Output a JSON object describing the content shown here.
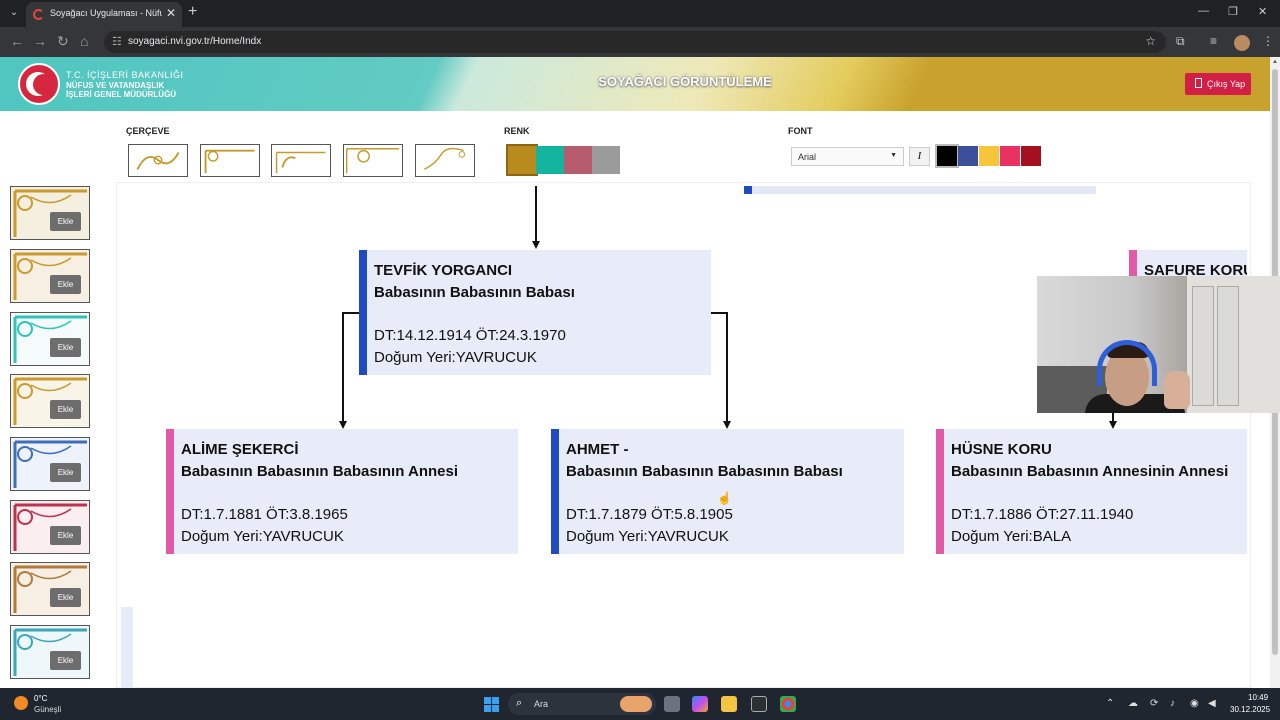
{
  "browser": {
    "tab_title": "Soyağacı Uygulaması - Nüfus ve Vatandaşlık",
    "tab_close": "✕",
    "new_tab": "+",
    "url": "soyagaci.nvi.gov.tr/Home/Indx",
    "window_controls": [
      "—",
      "❐",
      "✕"
    ]
  },
  "header": {
    "org_line1": "T.C. İÇİŞLERİ BAKANLIĞI",
    "org_line2": "NÜFUS VE VATANDAŞLIK",
    "org_line3": "İŞLERİ GENEL MÜDÜRLÜĞÜ",
    "title": "SOYAĞACI GÖRÜNTÜLEME",
    "logout_label": "Çıkış Yap"
  },
  "controls": {
    "frame_label": "ÇERÇEVE",
    "color_label": "RENK",
    "font_label": "FONT",
    "font_value": "Arial",
    "italic_label": "I",
    "frame_colors": [
      "#b98a1c",
      "#15b49e",
      "#b75c6e",
      "#9b9b9b"
    ],
    "font_colors": [
      "#000000",
      "#3b4f9a",
      "#f5c63a",
      "#ea3164",
      "#a4101f"
    ]
  },
  "themes": {
    "add_label": "Ekle",
    "items": [
      "gold-ornament",
      "gold-circle",
      "teal-lattice",
      "gold-frame",
      "blue-swirl",
      "red-ornament",
      "autumn-leaves",
      "teal-mosaic"
    ]
  },
  "tree": {
    "people": [
      {
        "name": "TEVFİK YORGANCI",
        "relation": "Babasının Babasının Babası",
        "dates": "DT:14.12.1914 ÖT:24.3.1970",
        "birthplace": "Doğum Yeri:YAVRUCUK",
        "gender": "male"
      },
      {
        "name": "ALİME ŞEKERCİ",
        "relation": "Babasının Babasının Babasının Annesi",
        "dates": "DT:1.7.1881 ÖT:3.8.1965",
        "birthplace": "Doğum Yeri:YAVRUCUK",
        "gender": "female"
      },
      {
        "name": "AHMET -",
        "relation": "Babasının Babasının Babasının Babası",
        "dates": "DT:1.7.1879 ÖT:5.8.1905",
        "birthplace": "Doğum Yeri:YAVRUCUK",
        "gender": "male"
      },
      {
        "name": "HÜSNE KORU",
        "relation": "Babasının Babasının Annesinin Annesi",
        "dates": "DT:1.7.1886 ÖT:27.11.1940",
        "birthplace": "Doğum Yeri:BALA",
        "gender": "female"
      },
      {
        "name": "SAFURE KORU",
        "gender": "female"
      }
    ],
    "colors": {
      "male": "#1e4bbf",
      "female": "#e05aa7",
      "card_bg": "#e8ecf8"
    }
  },
  "taskbar": {
    "temperature": "0°C",
    "weather": "Güneşli",
    "search_placeholder": "Ara",
    "time": "10:49",
    "date": "30.12.2025"
  }
}
